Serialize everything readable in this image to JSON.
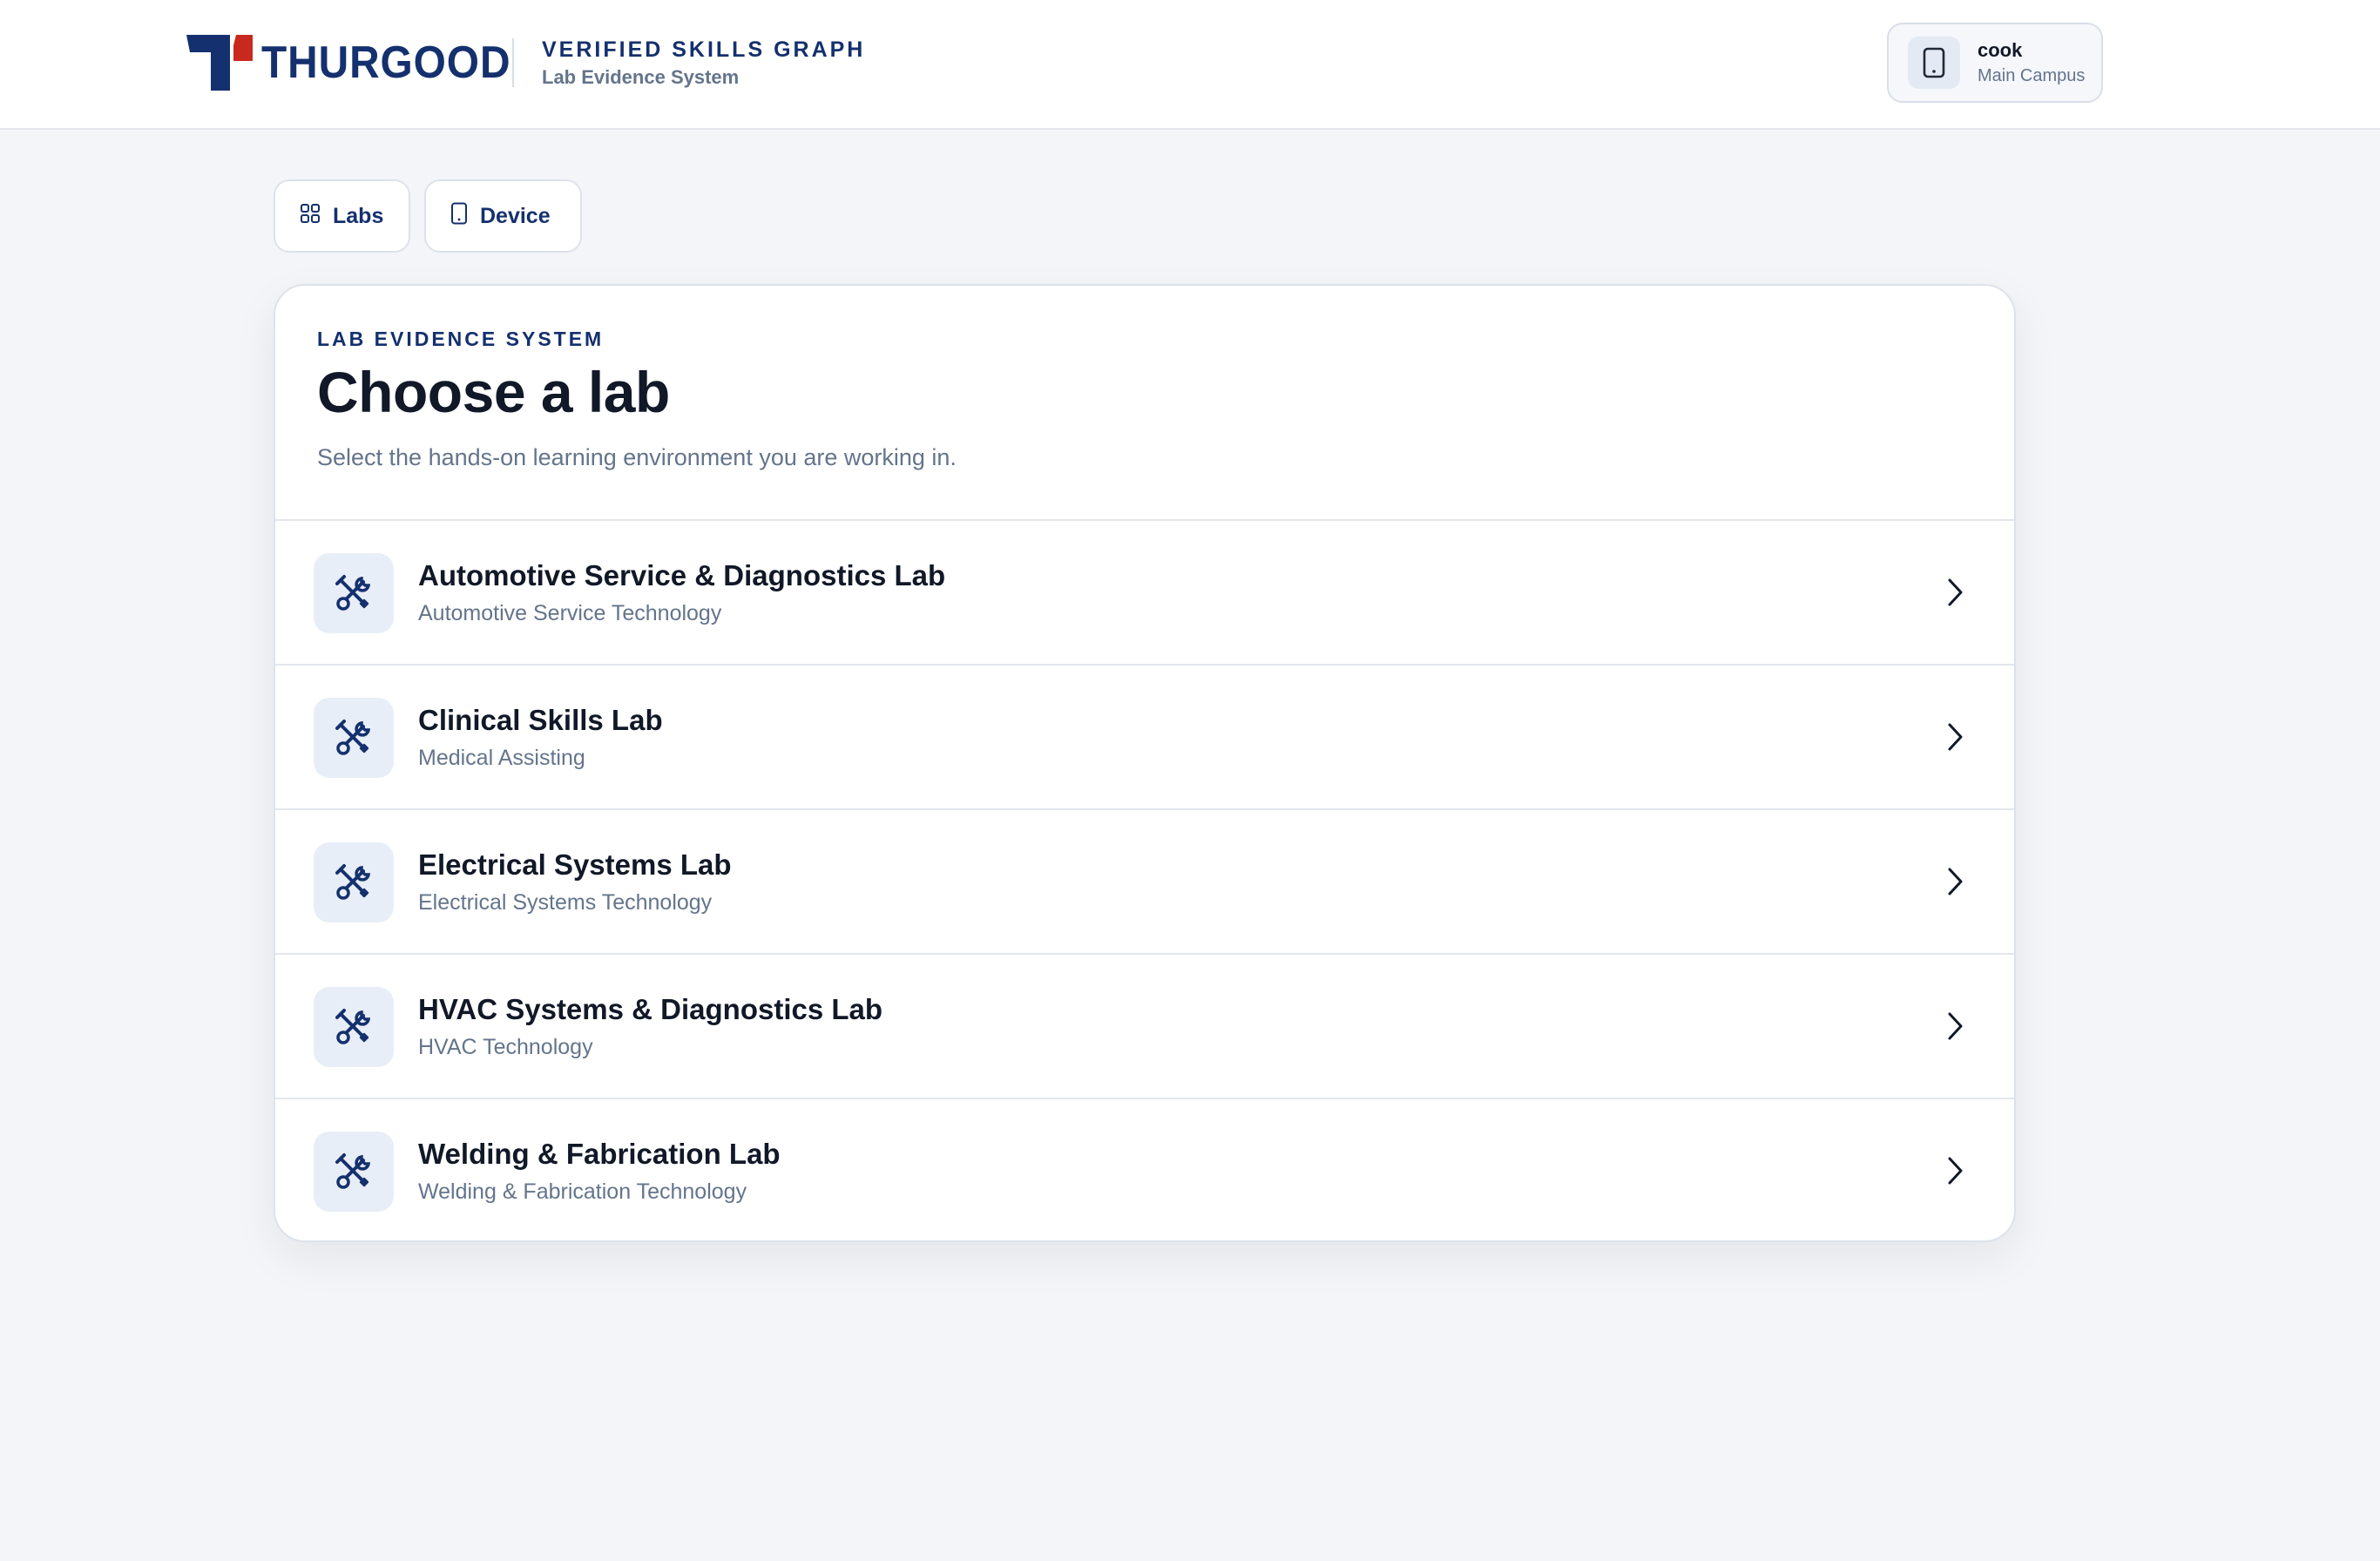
{
  "header": {
    "brand": "THURGOOD",
    "kicker": "VERIFIED SKILLS GRAPH",
    "subtitle": "Lab Evidence System",
    "device": {
      "name": "cook",
      "campus": "Main Campus",
      "icon": "tablet-icon"
    }
  },
  "nav": {
    "tabs": [
      {
        "label": "Labs",
        "icon": "grid-icon"
      },
      {
        "label": "Device",
        "icon": "tablet-icon"
      }
    ]
  },
  "main": {
    "kicker": "LAB EVIDENCE SYSTEM",
    "title": "Choose a lab",
    "subtitle": "Select the hands-on learning environment you are working in.",
    "labs": [
      {
        "name": "Automotive Service & Diagnostics Lab",
        "program": "Automotive Service Technology",
        "icon": "tools-icon"
      },
      {
        "name": "Clinical Skills Lab",
        "program": "Medical Assisting",
        "icon": "tools-icon"
      },
      {
        "name": "Electrical Systems Lab",
        "program": "Electrical Systems Technology",
        "icon": "tools-icon"
      },
      {
        "name": "HVAC Systems & Diagnostics Lab",
        "program": "HVAC Technology",
        "icon": "tools-icon"
      },
      {
        "name": "Welding & Fabrication Lab",
        "program": "Welding & Fabrication Technology",
        "icon": "tools-icon"
      }
    ]
  },
  "colors": {
    "brand_navy": "#14306e",
    "brand_red": "#c8291e",
    "page_bg": "#f4f5f8",
    "muted_text": "#64748b"
  }
}
